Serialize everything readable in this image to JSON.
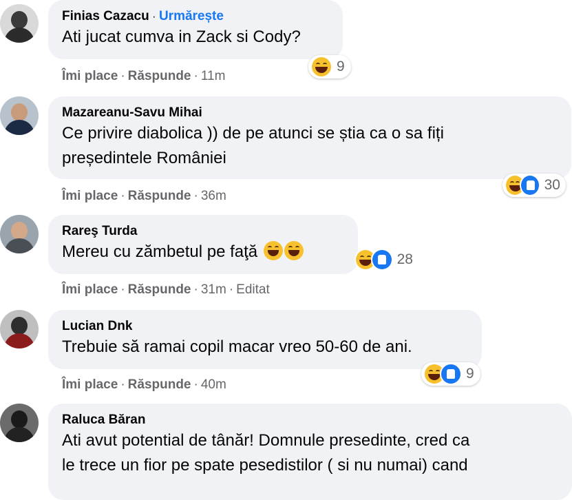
{
  "comments": [
    {
      "name": "Finias Cazacu",
      "follow": "Urmărește",
      "lines": [
        "Ati jucat cumva in Zack si Cody?"
      ],
      "like": "Îmi place",
      "reply": "Răspunde",
      "time": "11m",
      "reactions": [
        "haha-icon"
      ],
      "count": "9"
    },
    {
      "name": "Mazareanu-Savu Mihai",
      "lines": [
        "Ce privire diabolica )) de pe atunci se știa ca o sa fiți",
        "președintele României"
      ],
      "like": "Îmi place",
      "reply": "Răspunde",
      "time": "36m",
      "reactions": [
        "haha-icon",
        "like-icon"
      ],
      "count": "30"
    },
    {
      "name": "Rareş Turda",
      "lines": [
        "Mereu cu zămbetul pe faţă"
      ],
      "like": "Îmi place",
      "reply": "Răspunde",
      "time": "31m",
      "edited": "Editat",
      "reactions": [
        "haha-icon",
        "like-icon"
      ],
      "count": "28"
    },
    {
      "name": "Lucian Dnk",
      "lines": [
        "Trebuie să ramai copil macar vreo 50-60 de ani."
      ],
      "like": "Îmi place",
      "reply": "Răspunde",
      "time": "40m",
      "reactions": [
        "haha-icon",
        "like-icon"
      ],
      "count": "9"
    },
    {
      "name": "Raluca Băran",
      "lines": [
        "Ati avut potential de tânăr! Domnule presedinte, cred ca",
        "le trece un fior pe spate pesedistilor ( si nu numai) cand"
      ]
    }
  ],
  "separator": "·",
  "colors": {
    "link": "#1877f2",
    "bubble": "#f0f2f5",
    "meta": "#65676b"
  }
}
